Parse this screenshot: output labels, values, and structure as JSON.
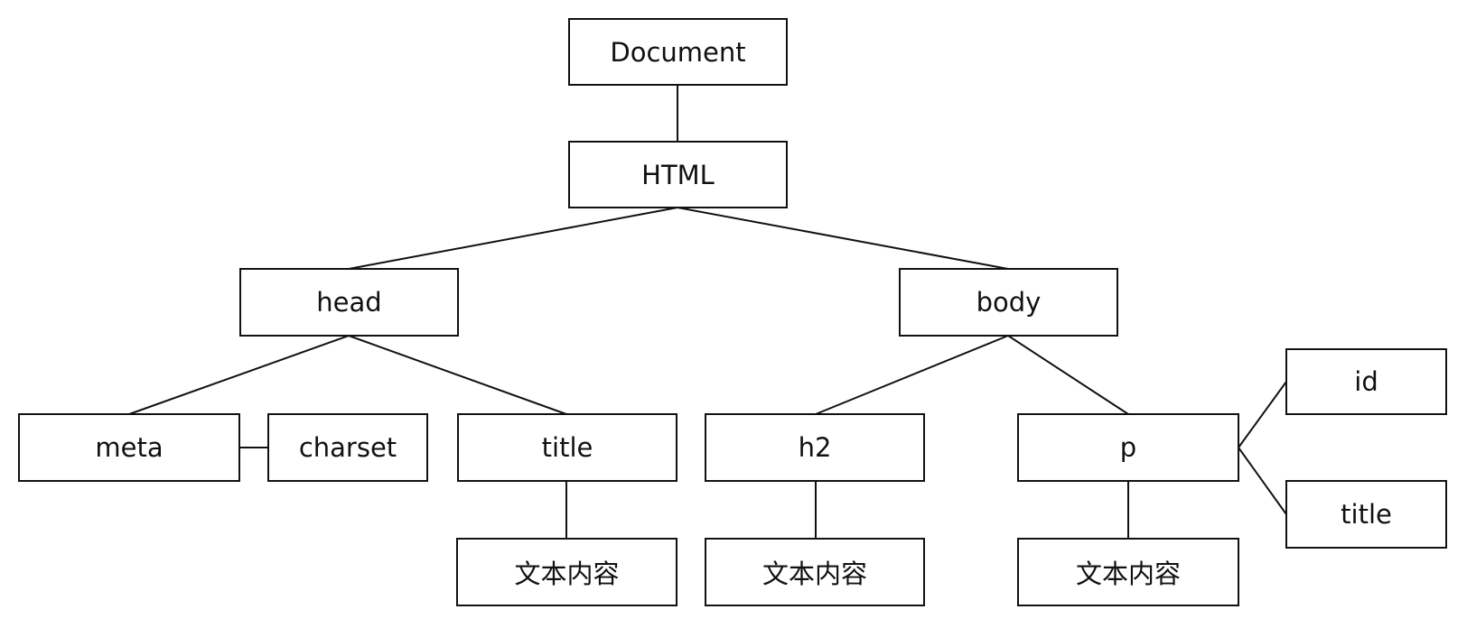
{
  "diagram": {
    "type": "dom-tree",
    "nodes": [
      {
        "id": "document",
        "label": "Document"
      },
      {
        "id": "html",
        "label": "HTML"
      },
      {
        "id": "head",
        "label": "head"
      },
      {
        "id": "body",
        "label": "body"
      },
      {
        "id": "meta",
        "label": "meta"
      },
      {
        "id": "charset",
        "label": "charset"
      },
      {
        "id": "title",
        "label": "title"
      },
      {
        "id": "h2",
        "label": "h2"
      },
      {
        "id": "p",
        "label": "p"
      },
      {
        "id": "attr-id",
        "label": "id"
      },
      {
        "id": "attr-title",
        "label": "title"
      },
      {
        "id": "title-text",
        "label": "文本内容"
      },
      {
        "id": "h2-text",
        "label": "文本内容"
      },
      {
        "id": "p-text",
        "label": "文本内容"
      }
    ],
    "edges": [
      [
        "document",
        "html"
      ],
      [
        "html",
        "head"
      ],
      [
        "html",
        "body"
      ],
      [
        "head",
        "meta"
      ],
      [
        "head",
        "title"
      ],
      [
        "meta",
        "charset"
      ],
      [
        "body",
        "h2"
      ],
      [
        "body",
        "p"
      ],
      [
        "p",
        "attr-id"
      ],
      [
        "p",
        "attr-title"
      ],
      [
        "title",
        "title-text"
      ],
      [
        "h2",
        "h2-text"
      ],
      [
        "p",
        "p-text"
      ]
    ]
  }
}
